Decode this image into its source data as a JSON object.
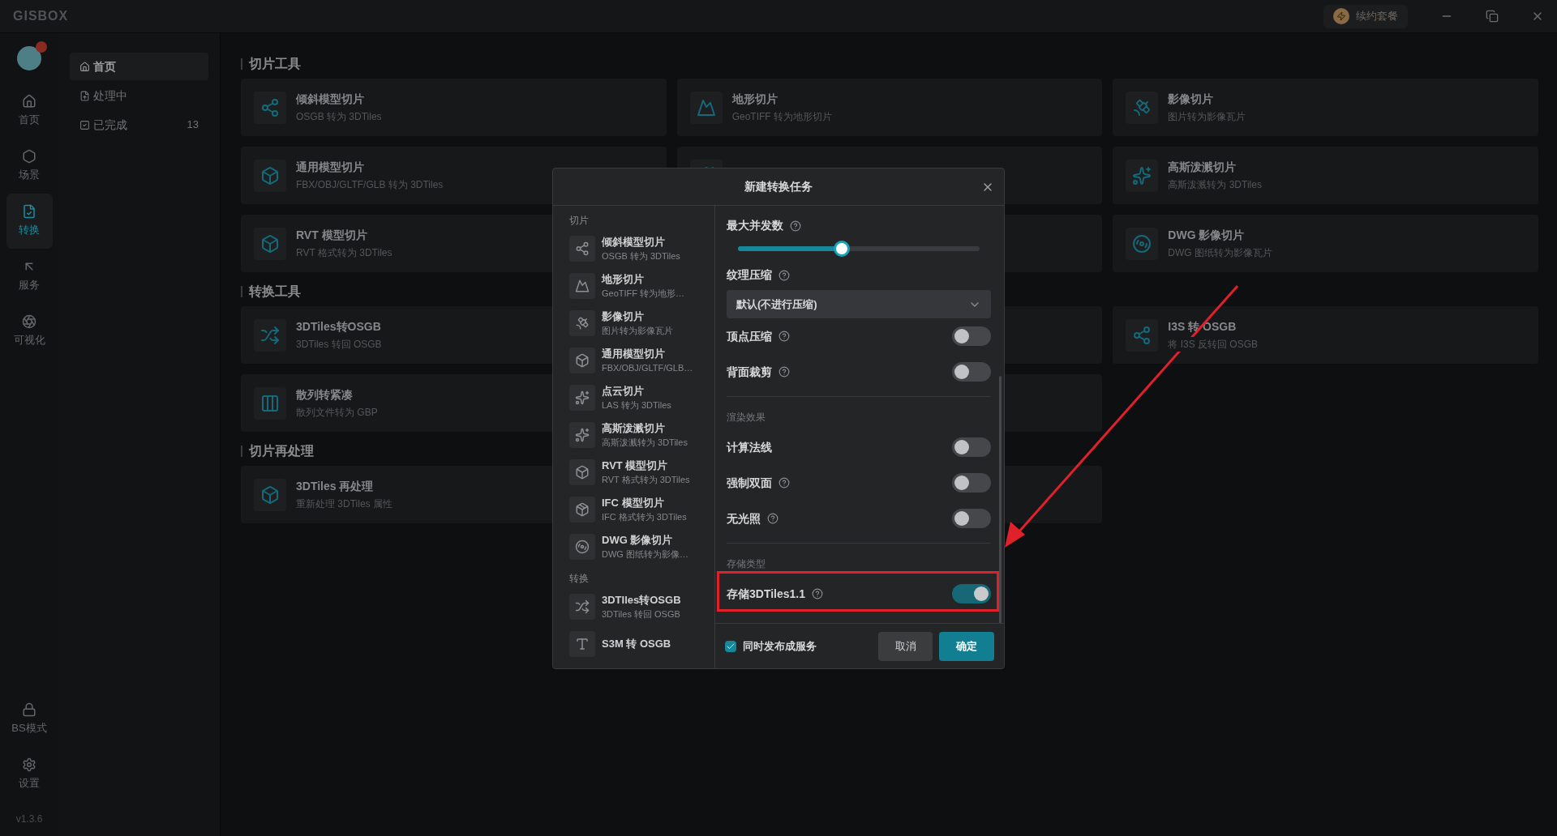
{
  "app": {
    "logo": "GISBOX",
    "renew_button": "续约套餐"
  },
  "rail": {
    "items": [
      {
        "label": "首页",
        "selected": false
      },
      {
        "label": "场景",
        "selected": false
      },
      {
        "label": "转换",
        "selected": true
      },
      {
        "label": "服务",
        "selected": false
      },
      {
        "label": "可视化",
        "selected": false
      }
    ],
    "bottom": [
      {
        "label": "BS模式"
      },
      {
        "label": "设置"
      }
    ],
    "version": "v1.3.6"
  },
  "subnav": [
    {
      "label": "首页",
      "selected": true
    },
    {
      "label": "处理中",
      "selected": false
    },
    {
      "label": "已完成",
      "selected": false,
      "count": "13"
    }
  ],
  "sections": [
    {
      "title": "切片工具",
      "cards": [
        {
          "kind": "tool",
          "title": "倾斜模型切片",
          "subtitle": "OSGB 转为 3DTiles"
        },
        {
          "kind": "tool",
          "title": "地形切片",
          "subtitle": "GeoTIFF 转为地形切片"
        },
        {
          "kind": "tool",
          "title": "影像切片",
          "subtitle": "图片转为影像瓦片"
        },
        {
          "kind": "tool",
          "title": "通用模型切片",
          "subtitle": "FBX/OBJ/GLTF/GLB 转为 3DTiles"
        },
        {
          "kind": "covered"
        },
        {
          "kind": "tool",
          "title": "高斯泼溅切片",
          "subtitle": "高斯泼溅转为 3DTiles"
        },
        {
          "kind": "tool",
          "title": "RVT 模型切片",
          "subtitle": "RVT 格式转为 3DTiles"
        },
        {
          "kind": "covered"
        },
        {
          "kind": "tool",
          "title": "DWG 影像切片",
          "subtitle": "DWG 图纸转为影像瓦片"
        }
      ]
    },
    {
      "title": "转换工具",
      "cards": [
        {
          "kind": "tool",
          "title": "3DTiles转OSGB",
          "subtitle": "3DTiles 转回 OSGB"
        },
        {
          "kind": "covered"
        },
        {
          "kind": "tool",
          "title": "I3S 转 OSGB",
          "subtitle": "将 I3S 反转回 OSGB"
        },
        {
          "kind": "tool",
          "title": "散列转紧凑",
          "subtitle": "散列文件转为 GBP"
        },
        {
          "kind": "covered"
        }
      ]
    },
    {
      "title": "切片再处理",
      "cards": [
        {
          "kind": "tool",
          "title": "3DTiles 再处理",
          "subtitle": "重新处理 3DTiles 属性"
        },
        {
          "kind": "covered"
        }
      ]
    }
  ],
  "dialog": {
    "title": "新建转换任务",
    "list": [
      {
        "heading": "切片",
        "items": [
          {
            "title": "倾斜模型切片",
            "subtitle": "OSGB 转为 3DTiles"
          },
          {
            "title": "地形切片",
            "subtitle": "GeoTIFF 转为地形…"
          },
          {
            "title": "影像切片",
            "subtitle": "图片转为影像瓦片"
          },
          {
            "title": "通用模型切片",
            "subtitle": "FBX/OBJ/GLTF/GLB…"
          },
          {
            "title": "点云切片",
            "subtitle": "LAS 转为 3DTiles"
          },
          {
            "title": "高斯泼溅切片",
            "subtitle": "高斯泼溅转为 3DTiles"
          },
          {
            "title": "RVT 模型切片",
            "subtitle": "RVT 格式转为 3DTiles"
          },
          {
            "title": "IFC 模型切片",
            "subtitle": "IFC 格式转为 3DTiles"
          },
          {
            "title": "DWG 影像切片",
            "subtitle": "DWG 图纸转为影像…"
          }
        ]
      },
      {
        "heading": "转换",
        "items": [
          {
            "title": "3DTIles转OSGB",
            "subtitle": "3DTiles 转回 OSGB"
          },
          {
            "title": "S3M 转 OSGB"
          }
        ]
      }
    ],
    "settings": [
      {
        "kind": "slider",
        "label": "最大并发数",
        "help": true,
        "level": 0.43
      },
      {
        "kind": "select",
        "label": "纹理压缩",
        "help": true,
        "value": "默认(不进行压缩)"
      },
      {
        "kind": "switch",
        "label": "顶点压缩",
        "help": true,
        "on": false
      },
      {
        "kind": "switch",
        "label": "背面裁剪",
        "help": true,
        "on": false
      },
      {
        "kind": "heading",
        "label": "渲染效果"
      },
      {
        "kind": "switch",
        "label": "计算法线",
        "help": false,
        "on": false
      },
      {
        "kind": "switch",
        "label": "强制双面",
        "help": true,
        "on": false
      },
      {
        "kind": "switch",
        "label": "无光照",
        "help": true,
        "on": false
      },
      {
        "kind": "heading",
        "label": "存储类型"
      },
      {
        "kind": "switch",
        "label": "存储3DTiles1.1",
        "help": true,
        "on": true
      }
    ],
    "publish": {
      "label": "同时发布成服务",
      "checked": true
    },
    "cancel": "取消",
    "confirm": "确定"
  }
}
